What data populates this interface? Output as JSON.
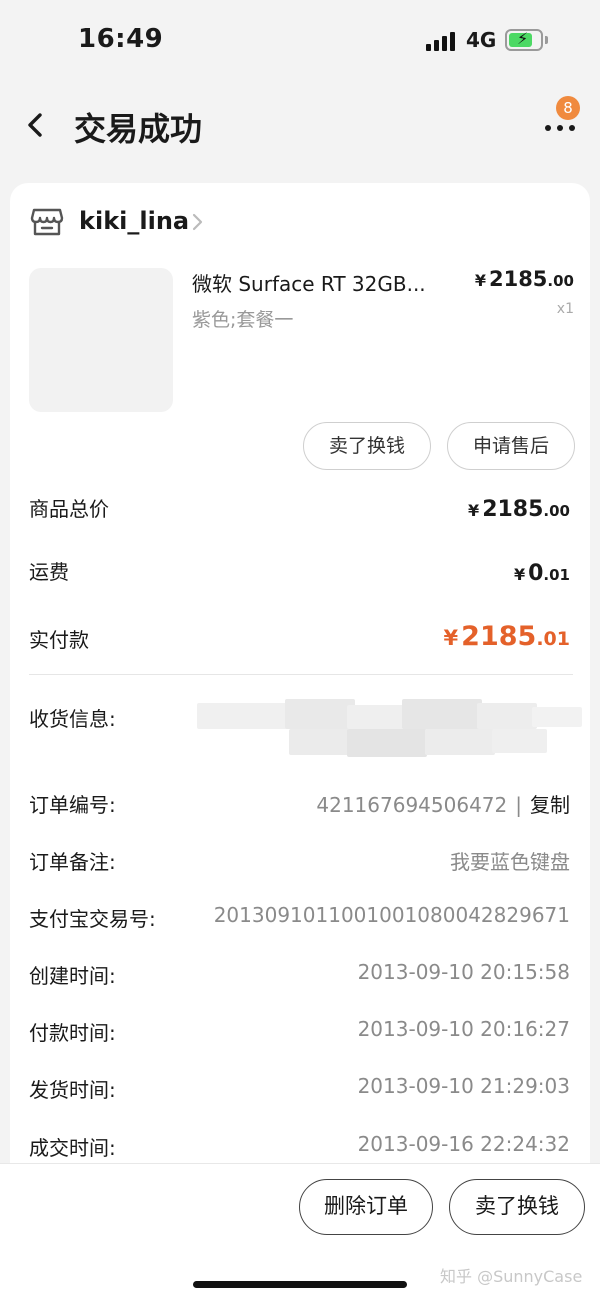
{
  "status_bar": {
    "time": "16:49",
    "network": "4G",
    "battery_level": 0.75
  },
  "nav": {
    "title": "交易成功",
    "badge_count": "8"
  },
  "shop": {
    "name": "kiki_lina"
  },
  "product": {
    "name": "微软 Surface RT 32GB...",
    "spec": "紫色;套餐一",
    "price_yen": "¥",
    "price_int": "2185",
    "price_dec": ".00",
    "quantity": "x1"
  },
  "product_actions": {
    "sell_label": "卖了换钱",
    "after_sale_label": "申请售后"
  },
  "summary": {
    "total_label": "商品总价",
    "total_int": "2185",
    "total_dec": ".00",
    "shipping_label": "运费",
    "shipping_int": "0",
    "shipping_dec": ".01",
    "paid_label": "实付款",
    "paid_int": "2185",
    "paid_dec": ".01",
    "currency": "¥"
  },
  "order_info": {
    "shipping_label": "收货信息:",
    "order_no_label": "订单编号:",
    "order_no": "421167694506472",
    "separator": "|",
    "copy_label": "复制",
    "note_label": "订单备注:",
    "note": "我要蓝色键盘",
    "alipay_label": "支付宝交易号:",
    "alipay_no": "2013091011001001080042829671",
    "created_label": "创建时间:",
    "created": "2013-09-10 20:15:58",
    "paid_time_label": "付款时间:",
    "paid_time": "2013-09-10 20:16:27",
    "shipped_label": "发货时间:",
    "shipped": "2013-09-10 21:29:03",
    "closed_label": "成交时间:",
    "closed": "2013-09-16 22:24:32"
  },
  "bottom_bar": {
    "delete_label": "删除订单",
    "sell_label": "卖了换钱"
  },
  "watermark": "知乎 @SunnyCase",
  "colors": {
    "accent": "#e4612a",
    "badge": "#f08a3e",
    "battery": "#4cd964"
  }
}
